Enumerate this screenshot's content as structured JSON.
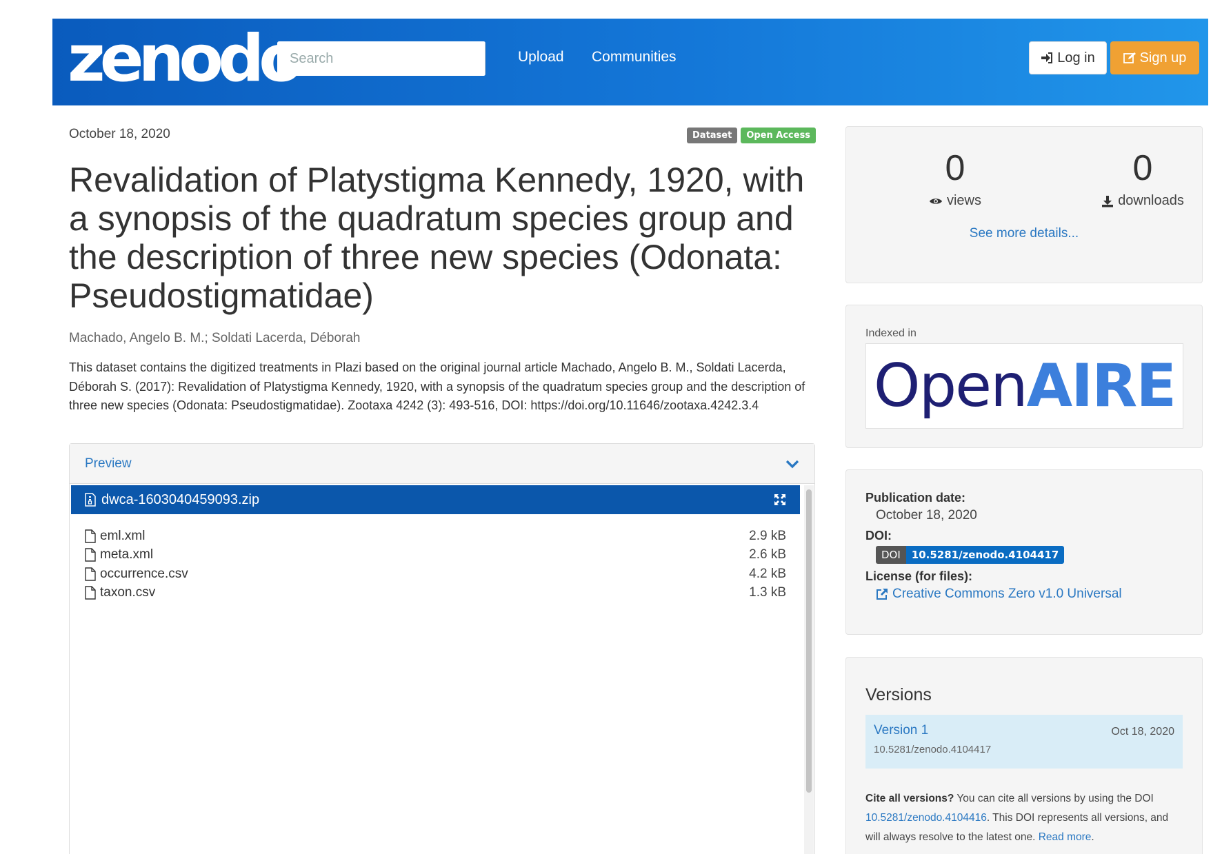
{
  "header": {
    "logo": "zenodo",
    "search_placeholder": "Search",
    "nav": [
      "Upload",
      "Communities"
    ],
    "login_label": "Log in",
    "signup_label": "Sign up",
    "colors": {
      "bar_start": "#0a5bbd",
      "bar_end": "#2196ea",
      "signup": "#f0a133"
    }
  },
  "record": {
    "date": "October 18, 2020",
    "badges": [
      "Dataset",
      "Open Access"
    ],
    "title": "Revalidation of Platystigma Kennedy, 1920, with a synopsis of the quadratum species group and the description of three new species (Odonata: Pseudostigmatidae)",
    "authors": "Machado, Angelo B. M.; Soldati Lacerda, Déborah",
    "description": "This dataset contains the digitized treatments in Plazi based on the original journal article Machado, Angelo B. M., Soldati Lacerda, Déborah S. (2017): Revalidation of Platystigma Kennedy, 1920, with a synopsis of the quadratum species group and the description of three new species (Odonata: Pseudostigmatidae). Zootaxa 4242 (3): 493-516, DOI: https://doi.org/10.11646/zootaxa.4242.3.4"
  },
  "preview": {
    "heading": "Preview",
    "archive_name": "dwca-1603040459093.zip",
    "files": [
      {
        "name": "eml.xml",
        "size": "2.9 kB"
      },
      {
        "name": "meta.xml",
        "size": "2.6 kB"
      },
      {
        "name": "occurrence.csv",
        "size": "4.2 kB"
      },
      {
        "name": "taxon.csv",
        "size": "1.3 kB"
      }
    ]
  },
  "stats": {
    "views": "0",
    "views_label": "views",
    "downloads": "0",
    "downloads_label": "downloads",
    "see_more": "See more details..."
  },
  "indexed": {
    "label": "Indexed in",
    "logo_part1": "Open",
    "logo_part2": "AIRE"
  },
  "meta": {
    "pubdate_label": "Publication date:",
    "pubdate": "October 18, 2020",
    "doi_label": "DOI:",
    "doi_prefix": "DOI",
    "doi": "10.5281/zenodo.4104417",
    "license_label": "License (for files):",
    "license": "Creative Commons Zero v1.0 Universal"
  },
  "versions": {
    "heading": "Versions",
    "items": [
      {
        "name": "Version 1",
        "date": "Oct 18, 2020",
        "doi": "10.5281/zenodo.4104417"
      }
    ],
    "cite_bold": "Cite all versions?",
    "cite_text1": " You can cite all versions by using the DOI ",
    "cite_doi": "10.5281/zenodo.4104416",
    "cite_text2": ". This DOI represents all versions, and will always resolve to the latest one. ",
    "read_more": "Read more",
    "cite_end": "."
  }
}
